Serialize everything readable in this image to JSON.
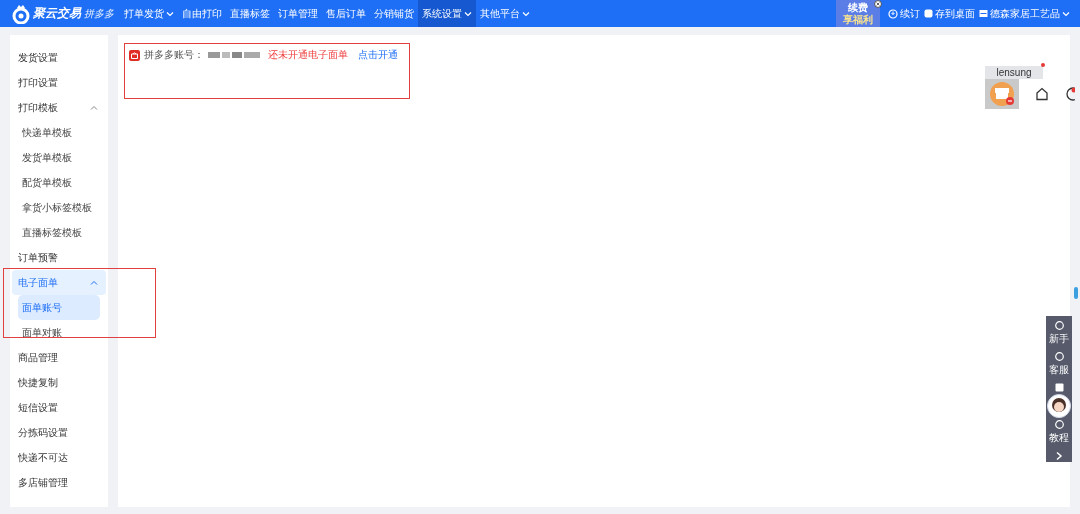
{
  "topbar": {
    "logo": "聚云交易",
    "logo_sub": "拼多多",
    "nav": [
      {
        "label": "打单发货",
        "dropdown": true,
        "selected": false
      },
      {
        "label": "自由打印",
        "dropdown": false,
        "selected": false
      },
      {
        "label": "直播标签",
        "dropdown": false,
        "selected": false
      },
      {
        "label": "订单管理",
        "dropdown": false,
        "selected": false
      },
      {
        "label": "售后订单",
        "dropdown": false,
        "selected": false
      },
      {
        "label": "分销铺货",
        "dropdown": false,
        "selected": false
      },
      {
        "label": "系统设置",
        "dropdown": true,
        "selected": true
      },
      {
        "label": "其他平台",
        "dropdown": true,
        "selected": false
      }
    ],
    "promo": [
      "续费",
      "享福利"
    ],
    "renew": "续订",
    "desktop": "存到桌面",
    "shop": "德森家居工艺品"
  },
  "sidebar": {
    "items": [
      {
        "label": "发货设置"
      },
      {
        "label": "打印设置"
      },
      {
        "label": "打印模板",
        "expanded": true,
        "children": [
          {
            "label": "快递单模板",
            "selected": false
          },
          {
            "label": "发货单模板",
            "selected": false
          },
          {
            "label": "配货单模板",
            "selected": false
          },
          {
            "label": "拿货小标签模板",
            "selected": false
          },
          {
            "label": "直播标签模板",
            "selected": false
          }
        ]
      },
      {
        "label": "订单预警"
      },
      {
        "label": "电子面单",
        "expanded": true,
        "children": [
          {
            "label": "面单账号",
            "selected": true
          },
          {
            "label": "面单对账",
            "selected": false
          }
        ]
      },
      {
        "label": "商品管理"
      },
      {
        "label": "快捷复制"
      },
      {
        "label": "短信设置"
      },
      {
        "label": "分拣码设置"
      },
      {
        "label": "快递不可达"
      },
      {
        "label": "多店铺管理"
      }
    ]
  },
  "notice": {
    "account_label": "拼多多账号：",
    "status": "还未开通电子面单",
    "action": "点击开通"
  },
  "assistant": {
    "user": "lensung"
  },
  "side_tools": [
    {
      "label": "新手"
    },
    {
      "label": "客服"
    },
    {
      "label": "教程"
    }
  ]
}
